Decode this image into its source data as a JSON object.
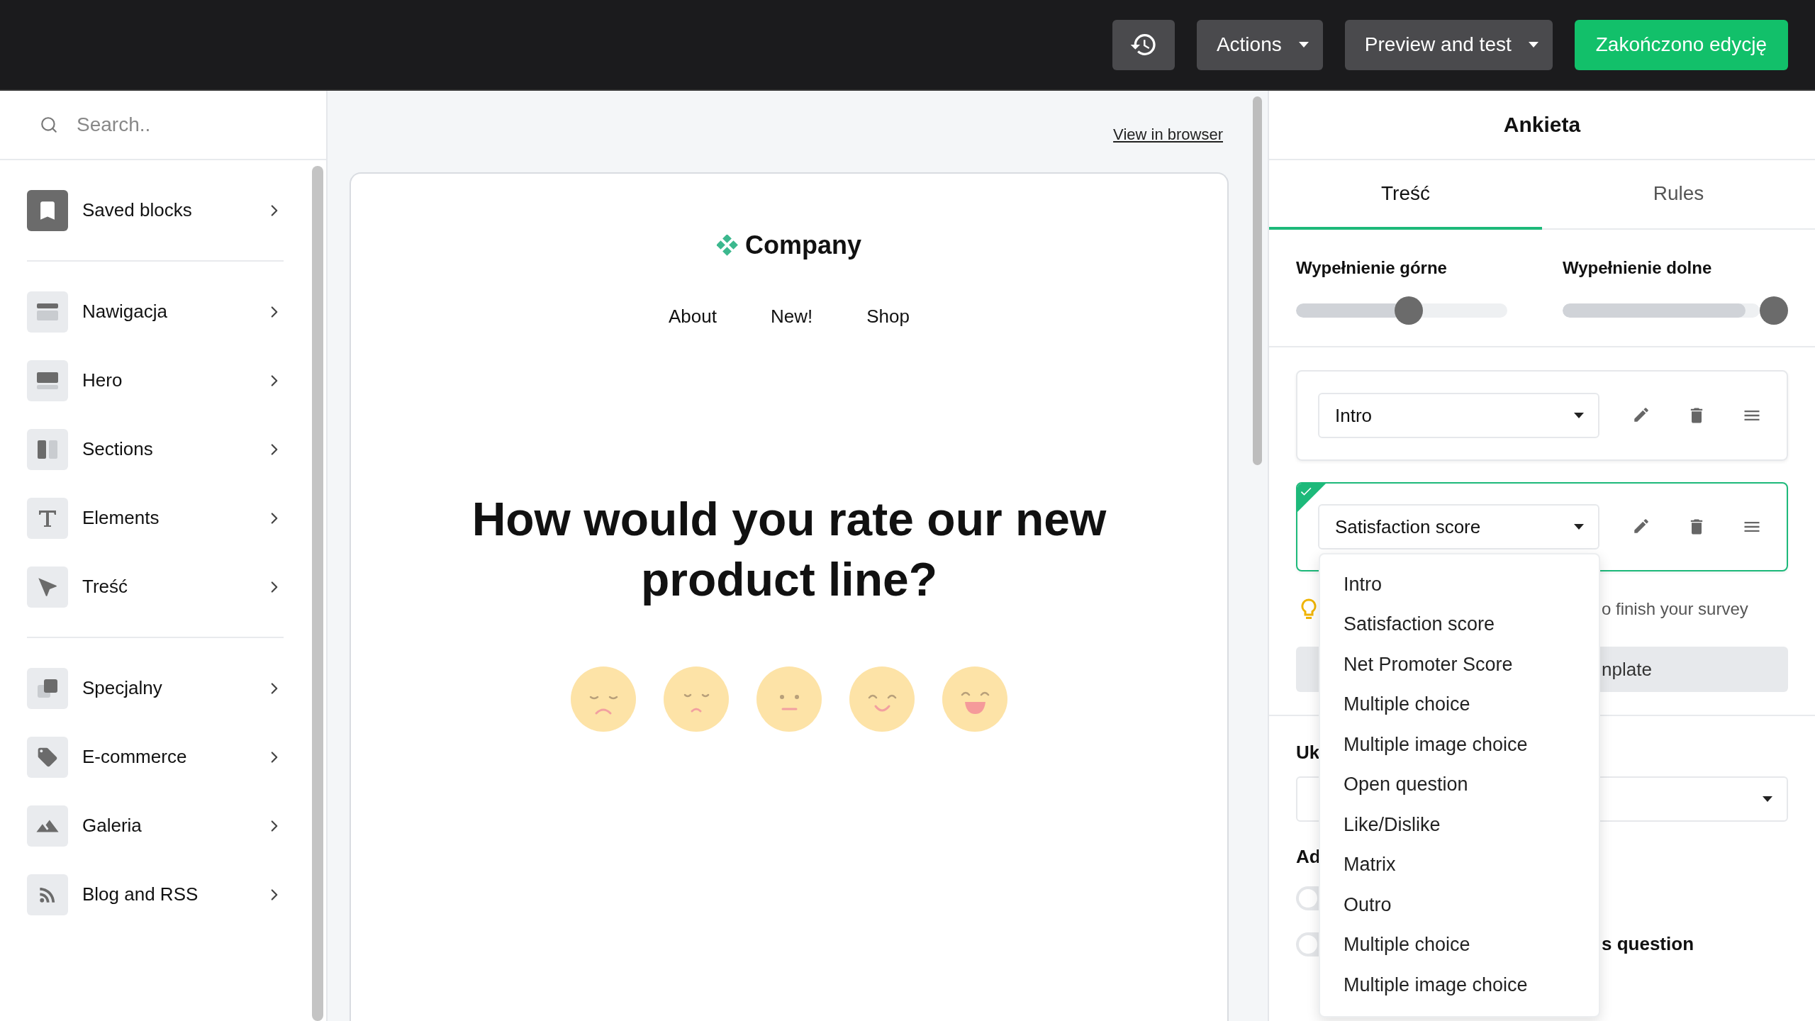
{
  "topbar": {
    "actions": [
      {
        "kind": "history"
      },
      {
        "kind": "menu",
        "label": "Actions"
      },
      {
        "kind": "menu",
        "label": "Preview and test"
      },
      {
        "kind": "primary",
        "label": "Zakończono edycję"
      }
    ]
  },
  "sidebar": {
    "search": {
      "placeholder": "Search.."
    },
    "groups": [
      [
        {
          "label": "Saved blocks",
          "kind": "bookmark"
        }
      ],
      [
        {
          "label": "Nawigacja",
          "kind": "navigation"
        },
        {
          "label": "Hero",
          "kind": "hero"
        },
        {
          "label": "Sections",
          "kind": "sections"
        },
        {
          "label": "Elements",
          "kind": "text"
        },
        {
          "label": "Treść",
          "kind": "cursor"
        }
      ],
      [
        {
          "label": "Specjalny",
          "kind": "layers"
        },
        {
          "label": "E-commerce",
          "kind": "tag"
        },
        {
          "label": "Galeria",
          "kind": "image"
        },
        {
          "label": "Blog and RSS",
          "kind": "rss"
        }
      ]
    ]
  },
  "preview": {
    "view_link": "View in browser",
    "brand": "Company",
    "nav": [
      "About",
      "New!",
      "Shop"
    ],
    "question": "How would you rate our new product line?",
    "ratings": [
      {
        "kind": "sad"
      },
      {
        "kind": "unhappy"
      },
      {
        "kind": "neutral"
      },
      {
        "kind": "smile"
      },
      {
        "kind": "happy"
      }
    ]
  },
  "panel": {
    "title": "Ankieta",
    "tabs": [
      {
        "label": "Treść",
        "selected": true
      },
      {
        "label": "Rules",
        "selected": false
      }
    ],
    "sliders": [
      {
        "label": "Wypełnienie górne",
        "level": 0.5
      },
      {
        "label": "Wypełnienie dolne",
        "level": 1
      }
    ],
    "blocks": [
      {
        "value": "Intro",
        "selected": false
      },
      {
        "value": "Satisfaction score",
        "selected": true
      }
    ],
    "tip": "o finish your survey",
    "template_button": "nplate",
    "label_1": "Uk",
    "label_2": "Ad",
    "toggles": [
      {
        "on": false
      },
      {
        "on": false,
        "label": "s question"
      }
    ],
    "dropdown": [
      "Intro",
      "Satisfaction score",
      "Net Promoter Score",
      "Multiple choice",
      "Multiple image choice",
      "Open question",
      "Like/Dislike",
      "Matrix",
      "Outro",
      "Multiple choice",
      "Multiple image choice"
    ]
  }
}
